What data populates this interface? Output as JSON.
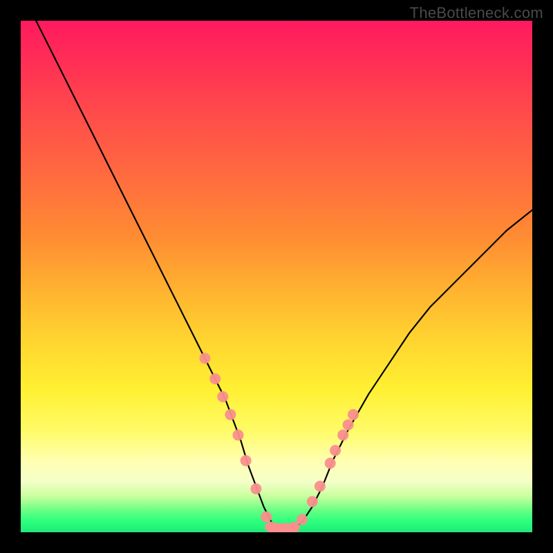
{
  "watermark": "TheBottleneck.com",
  "chart_data": {
    "type": "line",
    "title": "",
    "xlabel": "",
    "ylabel": "",
    "xlim": [
      0,
      100
    ],
    "ylim": [
      0,
      100
    ],
    "series": [
      {
        "name": "bottleneck-curve",
        "x": [
          3,
          6,
          10,
          14,
          18,
          22,
          26,
          30,
          32,
          34,
          36,
          38,
          40,
          41.5,
          43,
          44.5,
          46,
          47.5,
          49,
          51,
          53,
          55,
          57,
          59,
          61,
          64,
          68,
          72,
          76,
          80,
          85,
          90,
          95,
          100
        ],
        "values": [
          100,
          94,
          86,
          78,
          70,
          62,
          54,
          46,
          42,
          38,
          34,
          30,
          26,
          22,
          18,
          13,
          9,
          5,
          2,
          0.5,
          0.5,
          2,
          5,
          9,
          14,
          20,
          27,
          33,
          39,
          44,
          49,
          54,
          59,
          63
        ],
        "color": "#000000"
      }
    ],
    "dot_series": {
      "name": "sample-points",
      "color": "#fa8f8d",
      "points": [
        {
          "x": 36,
          "y": 34
        },
        {
          "x": 38,
          "y": 30
        },
        {
          "x": 39.5,
          "y": 26.5
        },
        {
          "x": 41,
          "y": 23
        },
        {
          "x": 42.5,
          "y": 19
        },
        {
          "x": 44,
          "y": 14
        },
        {
          "x": 46,
          "y": 8.5
        },
        {
          "x": 48,
          "y": 3
        },
        {
          "x": 49,
          "y": 1
        },
        {
          "x": 50.5,
          "y": 0.5
        },
        {
          "x": 52,
          "y": 0.5
        },
        {
          "x": 53.5,
          "y": 1
        },
        {
          "x": 55,
          "y": 2.5
        },
        {
          "x": 57,
          "y": 6
        },
        {
          "x": 58.5,
          "y": 9
        },
        {
          "x": 60.5,
          "y": 13.5
        },
        {
          "x": 61.5,
          "y": 16
        },
        {
          "x": 63,
          "y": 19
        },
        {
          "x": 64,
          "y": 21
        },
        {
          "x": 65,
          "y": 23
        }
      ]
    },
    "bottom_band": {
      "name": "target-markers",
      "color": "#fa8f8d",
      "x_start": 48.5,
      "x_end": 54,
      "y": 1
    }
  }
}
